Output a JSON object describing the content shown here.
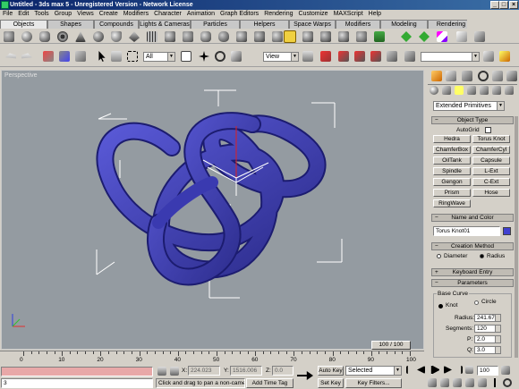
{
  "window": {
    "title": "Untitled - 3ds max 5 - Unregistered Version - Network License",
    "min": "_",
    "max": "□",
    "close": "×"
  },
  "menu": [
    "File",
    "Edit",
    "Tools",
    "Group",
    "Views",
    "Create",
    "Modifiers",
    "Character",
    "Animation",
    "Graph Editors",
    "Rendering",
    "Customize",
    "MAXScript",
    "Help"
  ],
  "tabs": [
    "Objects",
    "Shapes",
    "Compounds",
    "Lights & Cameras",
    "Particles",
    "Helpers",
    "Space Warps",
    "Modifiers",
    "Modeling",
    "Rendering"
  ],
  "main_toolbar": {
    "selection_filter": "All",
    "ref_coord": "View",
    "named_sel": ""
  },
  "viewport": {
    "label": "Perspective",
    "object_color": "#3a3ab0"
  },
  "command_panel": {
    "category": "Extended Primitives",
    "object_type": {
      "title": "Object Type",
      "autogrid": "AutoGrid",
      "buttons": [
        "Hedra",
        "Torus Knot",
        "ChamferBox",
        "ChamferCyl",
        "OilTank",
        "Capsule",
        "Spindle",
        "L-Ext",
        "Gengon",
        "C-Ext",
        "Prism",
        "Hose",
        "RingWave"
      ]
    },
    "name_color": {
      "title": "Name and Color",
      "name": "Torus Knot01",
      "color": "#4040d0"
    },
    "creation_method": {
      "title": "Creation Method",
      "opt1": "Diameter",
      "opt2": "Radius"
    },
    "keyboard_entry": {
      "title": "Keyboard Entry"
    },
    "parameters": {
      "title": "Parameters",
      "base_curve": "Base Curve",
      "knot": "Knot",
      "circle": "Circle",
      "radius_label": "Radius:",
      "radius": "241.678",
      "segments_label": "Segments:",
      "segments": "120",
      "p_label": "P:",
      "p": "2.0",
      "q_label": "Q:",
      "q": "3.0"
    }
  },
  "time": {
    "slider": "100 / 100",
    "ticks": [
      "0",
      "10",
      "20",
      "30",
      "40",
      "50",
      "60",
      "70",
      "80",
      "90",
      "100"
    ]
  },
  "status": {
    "listener": "3",
    "x_label": "X:",
    "x": "224.023",
    "y_label": "Y:",
    "y": "1516.006",
    "z_label": "Z:",
    "z": "0.0",
    "prompt": "Click and drag to pan a non-camer",
    "add_time_tag": "Add Time Tag",
    "auto_key": "Auto Key",
    "set_key": "Set Key",
    "selected": "Selected",
    "key_filters": "Key Filters...",
    "frame": "100"
  }
}
